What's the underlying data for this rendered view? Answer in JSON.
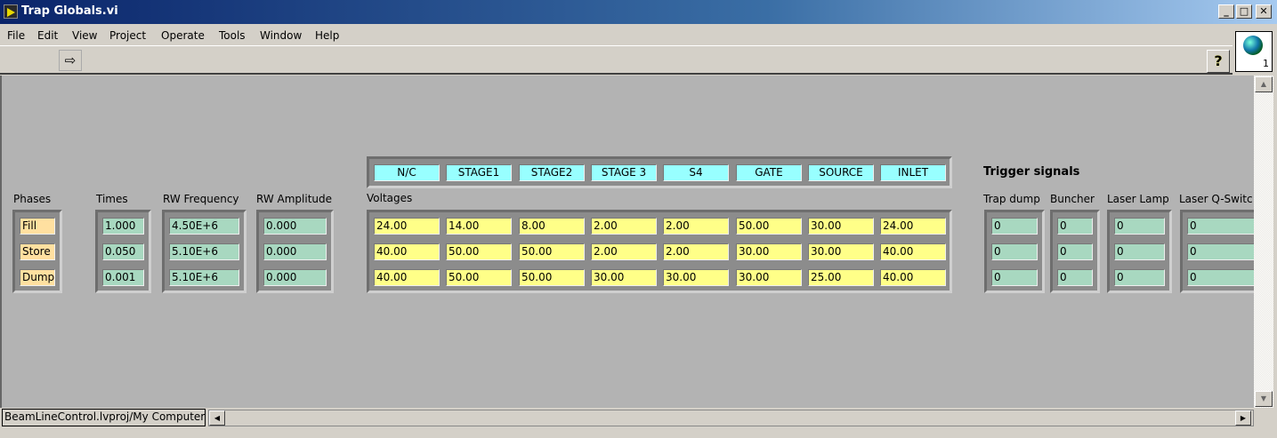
{
  "window": {
    "title": "Trap Globals.vi",
    "minimize": "_",
    "maximize": "□",
    "close": "✕"
  },
  "menu": [
    "File",
    "Edit",
    "View",
    "Project",
    "Operate",
    "Tools",
    "Window",
    "Help"
  ],
  "toolbar": {
    "run_icon": "run-arrow-icon",
    "help": "?"
  },
  "globe": {
    "icon": "globe-icon",
    "number": "1"
  },
  "status": {
    "path": "BeamLineControl.lvproj/My Computer"
  },
  "phases": {
    "label": "Phases",
    "values": [
      "Fill",
      "Store",
      "Dump"
    ]
  },
  "times": {
    "label": "Times",
    "values": [
      "1.000",
      "0.050",
      "0.001"
    ]
  },
  "rw_frequency": {
    "label": "RW Frequency",
    "values": [
      "4.50E+6",
      "5.10E+6",
      "5.10E+6"
    ]
  },
  "rw_amplitude": {
    "label": "RW Amplitude",
    "values": [
      "0.000",
      "0.000",
      "0.000"
    ]
  },
  "voltages": {
    "label": "Voltages",
    "headers": [
      "N/C",
      "STAGE1",
      "STAGE2",
      "STAGE 3",
      "S4",
      "GATE",
      "SOURCE",
      "INLET"
    ],
    "rows": [
      [
        "24.00",
        "14.00",
        "8.00",
        "2.00",
        "2.00",
        "50.00",
        "30.00",
        "24.00"
      ],
      [
        "40.00",
        "50.00",
        "50.00",
        "2.00",
        "2.00",
        "30.00",
        "30.00",
        "40.00"
      ],
      [
        "40.00",
        "50.00",
        "50.00",
        "30.00",
        "30.00",
        "30.00",
        "25.00",
        "40.00"
      ]
    ]
  },
  "trigger": {
    "title": "Trigger signals",
    "trap_dump": {
      "label": "Trap dump",
      "values": [
        "0",
        "0",
        "0"
      ]
    },
    "buncher": {
      "label": "Buncher",
      "values": [
        "0",
        "0",
        "0"
      ]
    },
    "laser_lamp": {
      "label": "Laser Lamp",
      "values": [
        "0",
        "0",
        "0"
      ]
    },
    "laser_qswitch": {
      "label": "Laser Q-Switc",
      "values": [
        "0",
        "0",
        "0"
      ]
    }
  },
  "colors": {
    "phase": "#ffe0a0",
    "numeric": "#a8d8c0",
    "voltage": "#ffff88",
    "header": "#98ffff",
    "canvas": "#b3b3b3"
  }
}
